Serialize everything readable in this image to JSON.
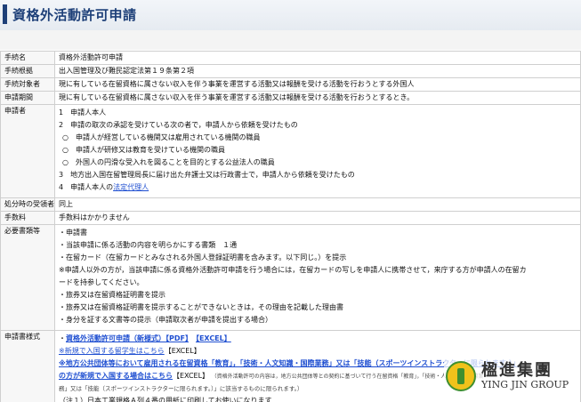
{
  "page_title": "資格外活動許可申請",
  "rows": {
    "procedure_name": {
      "label": "手続名",
      "value": "資格外活動許可申請"
    },
    "legal_basis": {
      "label": "手続根拠",
      "value": "出入国管理及び難民認定法第１９条第２項"
    },
    "applicant_target": {
      "label": "手続対象者",
      "value": "現に有している在留資格に属さない収入を伴う事業を運営する活動又は報酬を受ける活動を行おうとする外国人"
    },
    "application_period": {
      "label": "申請期間",
      "value": "現に有している在留資格に属さない収入を伴う事業を運営する活動又は報酬を受ける活動を行おうとするとき。"
    },
    "applicant": {
      "label": "申請者",
      "lines": [
        "1　申請人本人",
        "2　申請の取次の承認を受けている次の者で，申請人から依頼を受けたもの",
        "○　申請人が経営している機関又は雇用されている機関の職員",
        "○　申請人が研修又は教育を受けている機関の職員",
        "○　外国人の円滑な受入れを図ることを目的とする公益法人の職員",
        "3　地方出入国在留管理局長に届け出た弁護士又は行政書士で，申請人から依頼を受けたもの"
      ],
      "line4_prefix": "4　申請人本人の",
      "line4_link": "法定代理人"
    },
    "reception_place": {
      "label": "処分時の受領者",
      "value": "同上"
    },
    "fee": {
      "label": "手数料",
      "value": "手数料はかかりません"
    },
    "required_docs": {
      "label": "必要書類等",
      "lines": [
        "・申請書",
        "・当該申請に係る活動の内容を明らかにする書類　１通",
        "・在留カード（在留カードとみなされる外国人登録証明書を含みます。以下同じ。）を提示",
        "※申請人以外の方が，当該申請に係る資格外活動許可申請を行う場合には，在留カードの写しを申請人に携帯させて，来庁する方が申請人の在留カ",
        "ードを持参してください。",
        "・旅券又は在留資格証明書を提示",
        "・旅券又は在留資格証明書を提示することができないときは，その理由を記載した理由書",
        "・身分を証する文書等の提示（申請取次者が申請を提出する場合）"
      ]
    },
    "form_style": {
      "label": "申請書様式",
      "link1": "資格外活動許可申請（新様式）【PDF】",
      "link1b": "【EXCEL】",
      "link2": "※新規で入国する留学生はこちら",
      "link2_suffix": "【EXCEL】",
      "link3": "※地方公共団体等において雇用される在留資格「教育」，「技術・人文知識・国際業務」又は「技能（スポーツインストラクターに限られます。）」",
      "link3b": "の方が新規で入国する場合はこちら",
      "link3_suffix": "【EXCEL】",
      "note_small": "（資格外活動許可の内容は，地方公共団体等との契約に基づいて行う在留資格「教育」，「技術・人文知識・国際業",
      "note_small2": "務」又は「技能（スポーツインストラクターに限られます。）」に該当するものに限られます。）",
      "note_cut": "（注１）日本工業規格Ａ列４番の用紙に印刷してお使いになります"
    }
  },
  "watermark": {
    "chinese": "楹進集團",
    "english": "YING JIN GROUP",
    "colors": {
      "badge": "#f0c21b",
      "ring": "#3f8f2f"
    }
  }
}
